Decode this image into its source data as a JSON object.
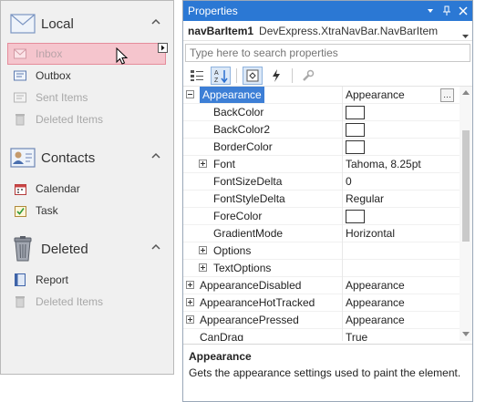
{
  "navbar": {
    "groups": [
      {
        "title": "Local",
        "icon": "envelope-icon",
        "items": [
          {
            "label": "Inbox",
            "icon": "inbox-icon",
            "selected": true,
            "enabled": true
          },
          {
            "label": "Outbox",
            "icon": "outbox-icon",
            "selected": false,
            "enabled": true
          },
          {
            "label": "Sent Items",
            "icon": "sent-items-icon",
            "selected": false,
            "enabled": false
          },
          {
            "label": "Deleted Items",
            "icon": "trash-icon",
            "selected": false,
            "enabled": false
          }
        ]
      },
      {
        "title": "Contacts",
        "icon": "contact-card-icon",
        "items": [
          {
            "label": "Calendar",
            "icon": "calendar-icon",
            "selected": false,
            "enabled": true
          },
          {
            "label": "Task",
            "icon": "task-icon",
            "selected": false,
            "enabled": true
          }
        ]
      },
      {
        "title": "Deleted",
        "icon": "trash-can-icon",
        "items": [
          {
            "label": "Report",
            "icon": "report-icon",
            "selected": false,
            "enabled": true
          },
          {
            "label": "Deleted Items",
            "icon": "trash-icon",
            "selected": false,
            "enabled": false
          }
        ]
      }
    ]
  },
  "properties": {
    "title": "Properties",
    "object_name": "navBarItem1",
    "object_type": "DevExpress.XtraNavBar.NavBarItem",
    "search_placeholder": "Type here to search properties",
    "rows": [
      {
        "name": "Appearance",
        "value": "Appearance",
        "level": 0,
        "expander": "minus",
        "selected": true,
        "ellipsis": true
      },
      {
        "name": "BackColor",
        "value": "",
        "level": 1,
        "swatch": true
      },
      {
        "name": "BackColor2",
        "value": "",
        "level": 1,
        "swatch": true
      },
      {
        "name": "BorderColor",
        "value": "",
        "level": 1,
        "swatch": true
      },
      {
        "name": "Font",
        "value": "Tahoma, 8.25pt",
        "level": 1,
        "expander": "plus"
      },
      {
        "name": "FontSizeDelta",
        "value": "0",
        "level": 1
      },
      {
        "name": "FontStyleDelta",
        "value": "Regular",
        "level": 1
      },
      {
        "name": "ForeColor",
        "value": "",
        "level": 1,
        "swatch": true
      },
      {
        "name": "GradientMode",
        "value": "Horizontal",
        "level": 1
      },
      {
        "name": "Options",
        "value": "",
        "level": 1,
        "expander": "plus"
      },
      {
        "name": "TextOptions",
        "value": "",
        "level": 1,
        "expander": "plus"
      },
      {
        "name": "AppearanceDisabled",
        "value": "Appearance",
        "level": 0,
        "expander": "plus"
      },
      {
        "name": "AppearanceHotTracked",
        "value": "Appearance",
        "level": 0,
        "expander": "plus"
      },
      {
        "name": "AppearancePressed",
        "value": "Appearance",
        "level": 0,
        "expander": "plus"
      },
      {
        "name": "CanDrag",
        "value": "True",
        "level": 0
      }
    ],
    "description": {
      "title": "Appearance",
      "text": "Gets the appearance settings used to paint the element."
    }
  },
  "colors": {
    "titlebar": "#2b78d4",
    "selected_row": "#3d7fd6",
    "selected_nav_item": "#f5c5cd"
  }
}
